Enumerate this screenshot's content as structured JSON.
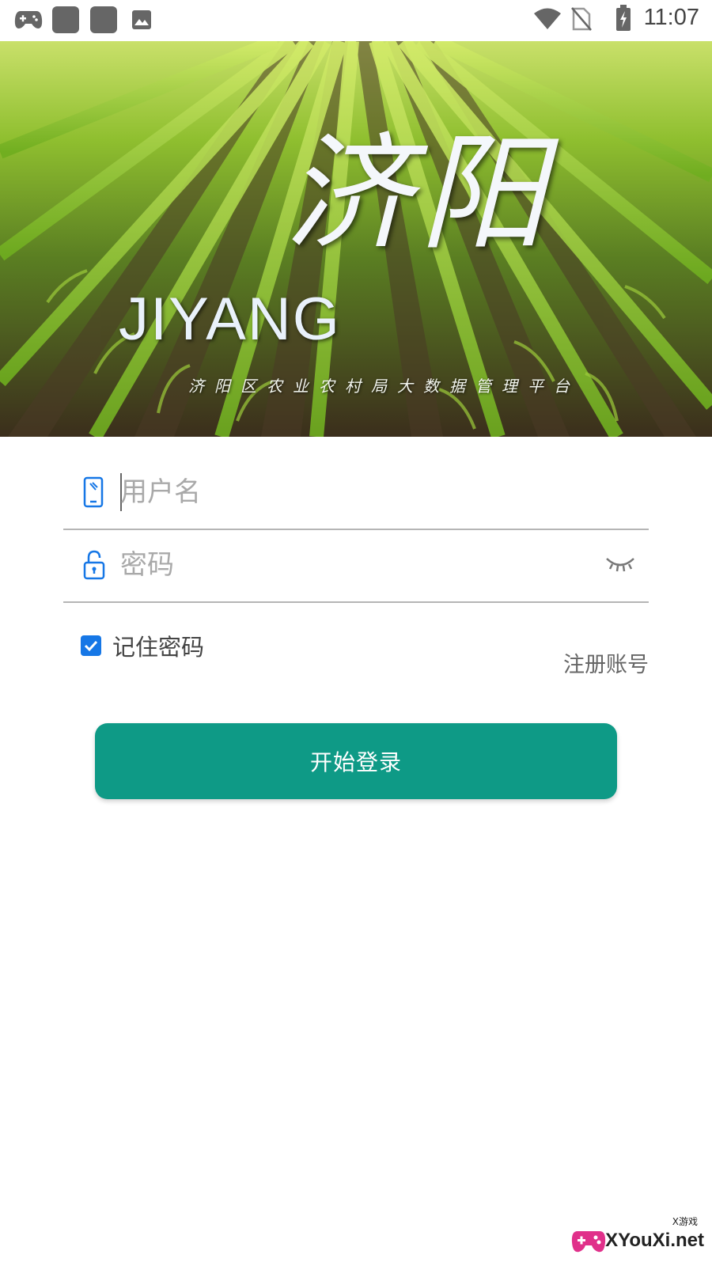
{
  "status_bar": {
    "time": "11:07",
    "icons_left": [
      "gamepad-icon",
      "app-square-icon",
      "app-square-icon",
      "image-icon"
    ],
    "icons_right": [
      "wifi-icon",
      "no-sim-icon",
      "battery-charging-icon"
    ]
  },
  "banner": {
    "logo_script": "济阳",
    "logo_latin": "JIYANG",
    "subtitle": "济阳区农业农村局大数据管理平台"
  },
  "login_form": {
    "username_placeholder": "用户名",
    "password_placeholder": "密码",
    "remember_label": "记住密码",
    "remember_checked": true,
    "register_label": "注册账号",
    "login_button_label": "开始登录"
  },
  "watermark": {
    "text": "XYouXi.net",
    "sub": "X游戏"
  },
  "colors": {
    "accent": "#0e9a86",
    "checkbox": "#1677e6",
    "icon_blue": "#1677e6",
    "divider": "#b5b5b5"
  }
}
